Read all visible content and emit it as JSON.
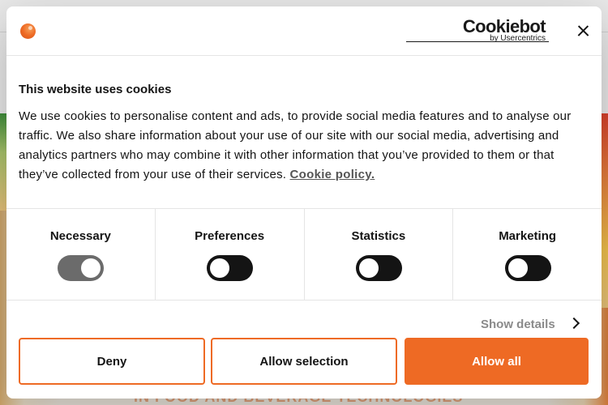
{
  "background": {
    "headline": "IN FOOD AND BEVERAGE TECHNOLOGIES"
  },
  "dialog": {
    "brand_icon": "brand-logo-dot",
    "logo": {
      "word": "Cookiebot",
      "sub": "by Usercentrics"
    },
    "close_icon": "close-icon",
    "title": "This website uses cookies",
    "body": "We use cookies to personalise content and ads, to provide social media features and to analyse our traffic. We also share information about your use of our site with our social media, advertising and analytics partners who may combine it with other information that you’ve provided to them or that they’ve collected from your use of their services.",
    "policy_link": "Cookie policy.",
    "categories": [
      {
        "label": "Necessary",
        "enabled": true
      },
      {
        "label": "Preferences",
        "enabled": false
      },
      {
        "label": "Statistics",
        "enabled": false
      },
      {
        "label": "Marketing",
        "enabled": false
      }
    ],
    "show_details": "Show details",
    "buttons": {
      "deny": "Deny",
      "allow_selection": "Allow selection",
      "allow_all": "Allow all"
    },
    "colors": {
      "accent": "#ee6a24",
      "toggle_off": "#141414",
      "toggle_on_disabled": "#6b6b6b"
    }
  }
}
